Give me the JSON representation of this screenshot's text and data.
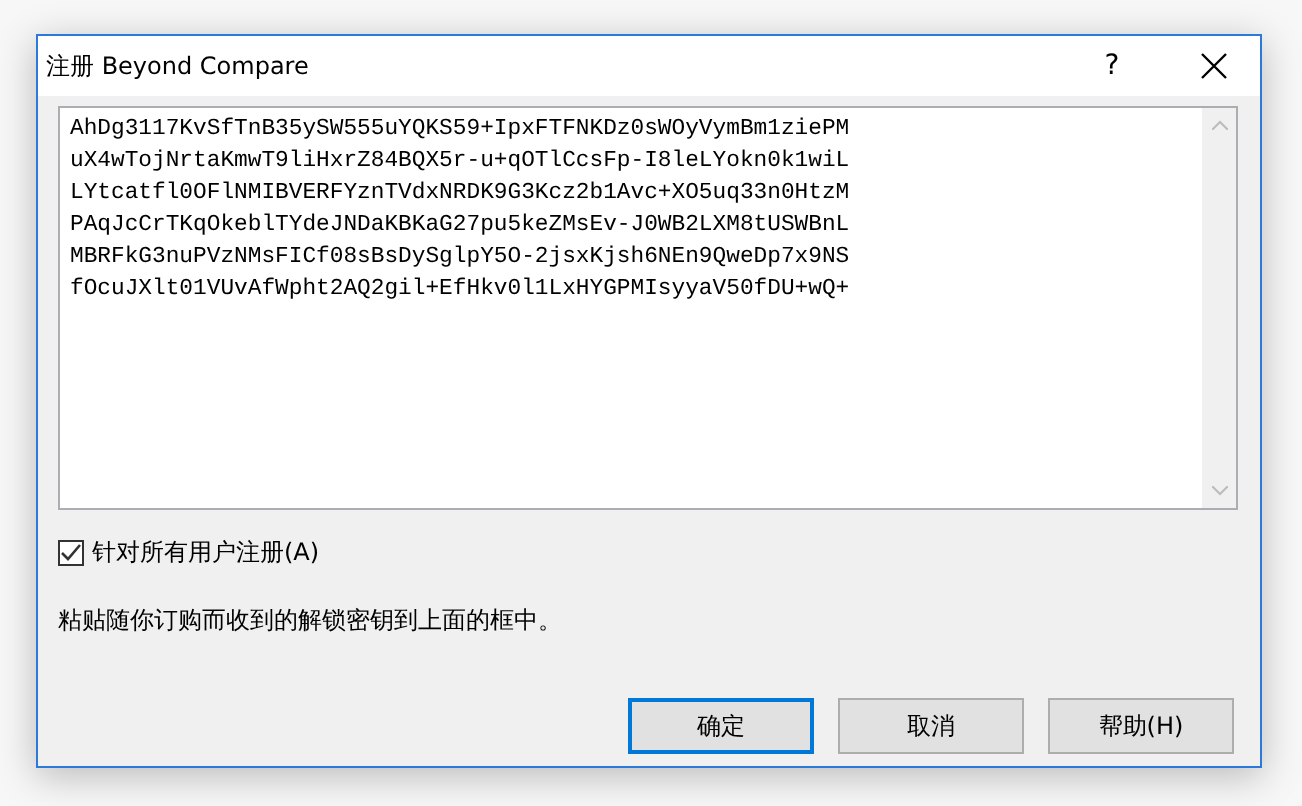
{
  "window": {
    "title": "注册 Beyond Compare",
    "help_button": "?"
  },
  "key_lines": [
    "AhDg3117KvSfTnB35ySW555uYQKS59+IpxFTFNKDz0sWOyVymBm1ziePM",
    "uX4wTojNrtaKmwT9liHxrZ84BQX5r-u+qOTlCcsFp-I8leLYokn0k1wiL",
    "LYtcatfl0OFlNMIBVERFYznTVdxNRDK9G3Kcz2b1Avc+XO5uq33n0HtzM",
    "PAqJcCrTKqOkeblTYdeJNDaKBKaG27pu5keZMsEv-J0WB2LXM8tUSWBnL",
    "MBRFkG3nuPVzNMsFICf08sBsDySglpY5O-2jsxKjsh6NEn9QweDp7x9NS",
    "fOcuJXlt01VUvAfWpht2AQ2gil+EfHkv0l1LxHYGPMIsyyaV50fDU+wQ+"
  ],
  "all_users_checkbox": {
    "label": "针对所有用户注册(A)",
    "checked": true
  },
  "hint": "粘贴随你订购而收到的解锁密钥到上面的框中。",
  "buttons": [
    {
      "label": "确定",
      "default": true
    },
    {
      "label": "取消",
      "default": false
    },
    {
      "label": "帮助(H)",
      "default": false
    }
  ]
}
